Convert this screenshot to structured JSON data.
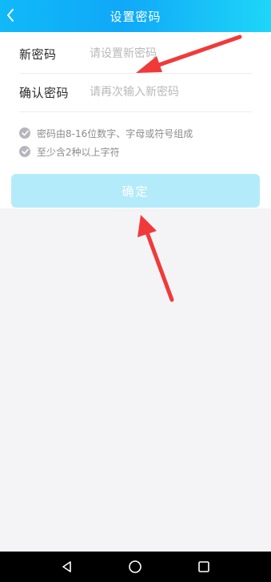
{
  "header": {
    "title": "设置密码",
    "back_icon": "chevron-left-icon",
    "background": "#10b9f8"
  },
  "form": {
    "new_password": {
      "label": "新密码",
      "placeholder": "请设置新密码",
      "value": ""
    },
    "confirm_password": {
      "label": "确认密码",
      "placeholder": "请再次输入新密码",
      "value": ""
    }
  },
  "rules": [
    {
      "icon": "check-circle-icon",
      "text": "密码由8-16位数字、字母或符号组成"
    },
    {
      "icon": "check-circle-icon",
      "text": "至少含2种以上字符"
    }
  ],
  "confirm_button": {
    "label": "确定",
    "color": "#b4ebfb"
  },
  "annotations": {
    "arrow_color": "#f03a3a"
  },
  "system_nav": {
    "back_icon": "triangle-back-icon",
    "home_icon": "circle-home-icon",
    "recent_icon": "square-recent-icon"
  }
}
